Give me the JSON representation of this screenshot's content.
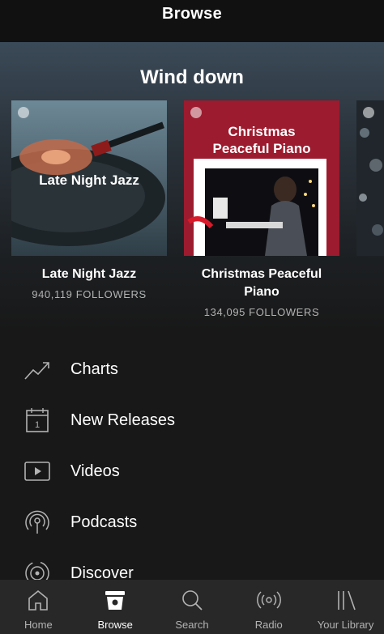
{
  "header": {
    "title": "Browse"
  },
  "section": {
    "title": "Wind down"
  },
  "playlists": [
    {
      "art_title": "Late Night Jazz",
      "name": "Late Night Jazz",
      "followers": "940,119 FOLLOWERS"
    },
    {
      "art_title_line1": "Christmas",
      "art_title_line2": "Peaceful Piano",
      "name_line1": "Christmas Peaceful",
      "name_line2": "Piano",
      "followers": "134,095 FOLLOWERS"
    }
  ],
  "nav": [
    {
      "label": "Charts",
      "icon": "trending-up-icon"
    },
    {
      "label": "New Releases",
      "icon": "calendar-icon"
    },
    {
      "label": "Videos",
      "icon": "video-play-icon"
    },
    {
      "label": "Podcasts",
      "icon": "podcast-icon"
    },
    {
      "label": "Discover",
      "icon": "discover-icon"
    }
  ],
  "tabs": [
    {
      "label": "Home",
      "icon": "home-icon"
    },
    {
      "label": "Browse",
      "icon": "browse-icon"
    },
    {
      "label": "Search",
      "icon": "search-icon"
    },
    {
      "label": "Radio",
      "icon": "radio-icon"
    },
    {
      "label": "Your Library",
      "icon": "library-icon"
    }
  ],
  "colors": {
    "background": "#181818",
    "tabbar": "#282828",
    "muted_text": "#b3b3b3",
    "christmas_red": "#9c1b2e"
  }
}
